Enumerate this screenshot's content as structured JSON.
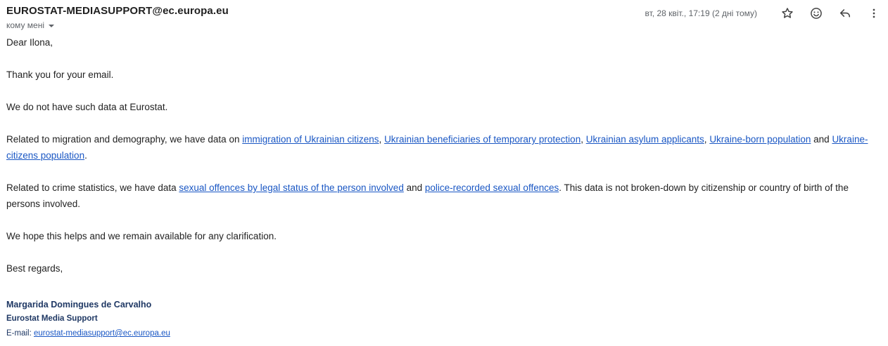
{
  "header": {
    "sender": "EUROSTAT-MEDIASUPPORT@ec.europa.eu",
    "recipient": "кому мені",
    "date": "вт, 28 квіт., 17:19 (2 дні тому)",
    "icons": [
      "star-icon",
      "emoji-icon",
      "reply-icon",
      "more-vert-icon"
    ]
  },
  "body": {
    "greeting": "Dear Ilona,",
    "thanks": "Thank you for your email.",
    "no_data": "We do not have such data at Eurostat.",
    "migration": {
      "intro": "Related to migration and demography, we have data on ",
      "link1": "immigration of Ukrainian citizens",
      "sep1": ", ",
      "link2": "Ukrainian beneficiaries of temporary protection",
      "sep2": ", ",
      "link3": "Ukrainian asylum applicants",
      "sep3": ", ",
      "link4": "Ukraine-born population",
      "and": " and ",
      "link5": "Ukraine-citizens population",
      "end": "."
    },
    "crime": {
      "intro": "Related to crime statistics, we have data ",
      "link1": "sexual offences by legal status of the person involved",
      "and": " and ",
      "link2": "police-recorded sexual offences",
      "rest": ". This data is not broken-down by citizenship or country of birth of the persons involved."
    },
    "hope": "We hope this helps and we remain available for any clarification.",
    "closing": "Best regards,"
  },
  "signature": {
    "name": "Margarida Domingues de Carvalho",
    "org": "Eurostat Media Support",
    "email_label": "E-mail: ",
    "email": "eurostat-mediasupport@ec.europa.eu"
  },
  "colors": {
    "link": "#1a57c4",
    "signature": "#1f3864",
    "meta_text": "#5f6368"
  }
}
